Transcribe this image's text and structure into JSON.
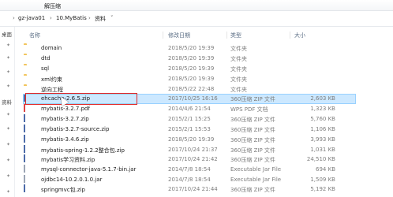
{
  "ribbon": {
    "tab_label": "解压缩"
  },
  "address": {
    "crumbs": [
      "gz-java01",
      "10.MyBatis",
      "资料"
    ]
  },
  "nav": {
    "items": [
      "桌面",
      "资料"
    ]
  },
  "columns": {
    "name": "名称",
    "date": "修改日期",
    "type": "类型",
    "size": "大小"
  },
  "files": [
    {
      "name": "domain",
      "date": "2018/5/20 19:39",
      "type": "文件夹",
      "size": "",
      "icon": "folder-icon"
    },
    {
      "name": "dtd",
      "date": "2018/5/20 19:39",
      "type": "文件夹",
      "size": "",
      "icon": "folder-icon"
    },
    {
      "name": "sql",
      "date": "2018/5/20 19:39",
      "type": "文件夹",
      "size": "",
      "icon": "folder-icon"
    },
    {
      "name": "xml约束",
      "date": "2018/5/20 19:39",
      "type": "文件夹",
      "size": "",
      "icon": "folder-icon"
    },
    {
      "name": "逆向工程",
      "date": "2018/5/22 22:48",
      "type": "文件夹",
      "size": "",
      "icon": "folder-icon"
    },
    {
      "name": "ehcache-2.6.5.zip",
      "date": "2017/10/25 16:16",
      "type": "360压缩 ZIP 文件",
      "size": "2,603 KB",
      "icon": "zip-icon"
    },
    {
      "name": "mybatis-3.2.7.pdf",
      "date": "2014/4/6 21:54",
      "type": "WPS PDF 文档",
      "size": "1,323 KB",
      "icon": "pdf-icon"
    },
    {
      "name": "mybatis-3.2.7.zip",
      "date": "2015/2/1 15:25",
      "type": "360压缩 ZIP 文件",
      "size": "5,760 KB",
      "icon": "zip-icon"
    },
    {
      "name": "mybatis-3.2.7-source.zip",
      "date": "2015/2/1 15:53",
      "type": "360压缩 ZIP 文件",
      "size": "1,106 KB",
      "icon": "zip-icon"
    },
    {
      "name": "mybatis-3.4.6.zip",
      "date": "2018/5/20 19:39",
      "type": "360压缩 ZIP 文件",
      "size": "3,993 KB",
      "icon": "zip-icon"
    },
    {
      "name": "mybatis-spring-1.2.2整合包.zip",
      "date": "2017/10/24 21:37",
      "type": "360压缩 ZIP 文件",
      "size": "1,031 KB",
      "icon": "zip-icon"
    },
    {
      "name": "mybatis学习资料.zip",
      "date": "2017/10/24 21:42",
      "type": "360压缩 ZIP 文件",
      "size": "24,510 KB",
      "icon": "zip-icon"
    },
    {
      "name": "mysql-connector-java-5.1.7-bin.jar",
      "date": "2014/7/8 18:54",
      "type": "Executable Jar File",
      "size": "694 KB",
      "icon": "jar-icon"
    },
    {
      "name": "ojdbc14-10.2.0.1.0.jar",
      "date": "2014/7/8 18:54",
      "type": "Executable Jar File",
      "size": "1,509 KB",
      "icon": "jar-icon"
    },
    {
      "name": "springmvc包.zip",
      "date": "2017/10/24 21:44",
      "type": "360压缩 ZIP 文件",
      "size": "5,192 KB",
      "icon": "zip-icon"
    }
  ]
}
